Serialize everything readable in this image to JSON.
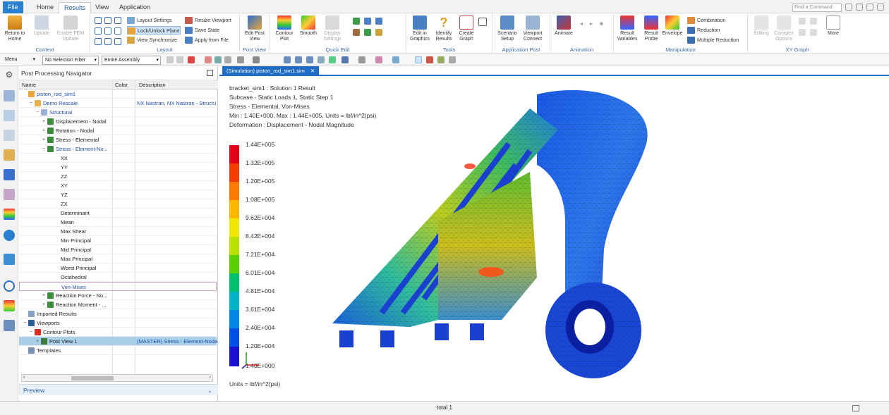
{
  "menubar": {
    "tabs": [
      "File",
      "Home",
      "Results",
      "View",
      "Application"
    ],
    "find_placeholder": "Find a Command"
  },
  "ribbon": {
    "context": {
      "title": "Context",
      "return_home": "Return to Home",
      "update": "Update",
      "enable_fem_update": "Enable FEM Update"
    },
    "layout": {
      "title": "Layout",
      "layout_settings": "Layout Settings",
      "lock_unlock_plane": "Lock/Unlock Plane",
      "view_synchronize": "View Synchronize",
      "resize_viewport": "Resize Viewport",
      "save_state": "Save State",
      "apply_from_file": "Apply from File"
    },
    "post_view": {
      "title": "Post View",
      "edit_post_view": "Edit Post View"
    },
    "quick_edit": {
      "title": "Quick Edit",
      "contour_plot": "Contour Plot",
      "smooth": "Smooth",
      "display_settings": "Display Settings"
    },
    "tools": {
      "title": "Tools",
      "edit_in_graphics": "Edit in Graphics",
      "identify_results": "Identify Results",
      "create_graph": "Create Graph"
    },
    "application_post": {
      "title": "Application Post",
      "scenario_setup": "Scenario Setup",
      "viewport_connect": "Viewport Connect"
    },
    "animation": {
      "title": "Animation",
      "animate": "Animate"
    },
    "manipulation": {
      "title": "Manipulation",
      "result_variables": "Result Variables",
      "result_probe": "Result Probe",
      "envelope": "Envelope",
      "combination": "Combination",
      "reduction": "Reduction",
      "multiple_reduction": "Multiple Reduction"
    },
    "xy_graph": {
      "title": "XY Graph",
      "editing": "Editing",
      "complex_options": "Complex Options",
      "more": "More"
    }
  },
  "toolbar2": {
    "menu": "Menu",
    "selection_filter": "No Selection Filter",
    "assembly_scope": "Entire Assembly"
  },
  "navigator": {
    "title": "Post Processing Navigator",
    "columns": {
      "name": "Name",
      "color": "Color",
      "description": "Description"
    },
    "rows": [
      {
        "label": "piston_rod_sim1",
        "desc": ""
      },
      {
        "label": "Demo Rescale",
        "desc": "NX Nastran, NX Nastran - Structu"
      },
      {
        "label": "Structural",
        "desc": ""
      },
      {
        "label": "Displacement - Nodal",
        "desc": ""
      },
      {
        "label": "Rotation - Nodal",
        "desc": ""
      },
      {
        "label": "Stress - Elemental",
        "desc": ""
      },
      {
        "label": "Stress - Element-No...",
        "desc": ""
      },
      {
        "label": "XX",
        "desc": ""
      },
      {
        "label": "YY",
        "desc": ""
      },
      {
        "label": "ZZ",
        "desc": ""
      },
      {
        "label": "XY",
        "desc": ""
      },
      {
        "label": "YZ",
        "desc": ""
      },
      {
        "label": "ZX",
        "desc": ""
      },
      {
        "label": "Determinant",
        "desc": ""
      },
      {
        "label": "Mean",
        "desc": ""
      },
      {
        "label": "Max Shear",
        "desc": ""
      },
      {
        "label": "Min Principal",
        "desc": ""
      },
      {
        "label": "Mid Principal",
        "desc": ""
      },
      {
        "label": "Max Principal",
        "desc": ""
      },
      {
        "label": "Worst Principal",
        "desc": ""
      },
      {
        "label": "Octahedral",
        "desc": ""
      },
      {
        "label": "Von-Mises",
        "desc": ""
      },
      {
        "label": "Reaction Force - No...",
        "desc": ""
      },
      {
        "label": "Reaction Moment - ...",
        "desc": ""
      },
      {
        "label": "Imported Results",
        "desc": ""
      },
      {
        "label": "Viewports",
        "desc": ""
      },
      {
        "label": "Contour Plots",
        "desc": ""
      },
      {
        "label": "Post View 1",
        "desc": "(MASTER) Stress - Element-Noda"
      },
      {
        "label": "Templates",
        "desc": ""
      }
    ],
    "preview": "Preview"
  },
  "graphics": {
    "tab_title": "(Simulation) piston_rod_sim1.sim",
    "info_lines": [
      "bracket_sim1 : Solution 1 Result",
      "Subcase - Static Loads 1, Static Step 1",
      "Stress - Elemental, Von-Mises",
      "Min : 1.40E+000, Max : 1.44E+005, Units = lbf/in^2(psi)",
      "Deformation : Displacement - Nodal Magnitude"
    ],
    "legend_labels": [
      "1.44E+005",
      "1.32E+005",
      "1.20E+005",
      "1.08E+005",
      "9.62E+004",
      "8.42E+004",
      "7.21E+004",
      "6.01E+004",
      "4.81E+004",
      "3.61E+004",
      "2.40E+004",
      "1.20E+004",
      "1.40E+000"
    ],
    "units": "Units = lbf/in^2(psi)"
  },
  "statusbar": {
    "text": "total 1"
  },
  "colors": {
    "accent": "#1f6cc4",
    "selected_row": "#a9cfe9"
  }
}
